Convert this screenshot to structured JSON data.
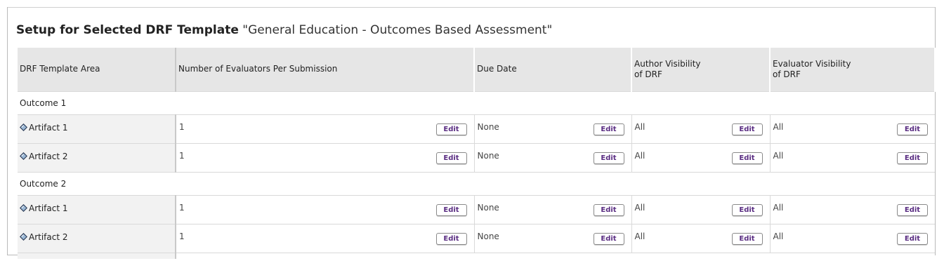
{
  "header": {
    "title_bold": "Setup for Selected DRF Template",
    "title_rest": "\"General Education - Outcomes Based Assessment\""
  },
  "table": {
    "columns": [
      "DRF Template Area",
      "Number of Evaluators Per Submission",
      "Due Date",
      "Author Visibility\nof DRF",
      "Evaluator Visibility\nof DRF"
    ],
    "edit_label": "Edit",
    "groups": [
      {
        "name": "Outcome 1",
        "rows": [
          {
            "area": "Artifact 1",
            "evaluators": "1",
            "due_date": "None",
            "author_visibility": "All",
            "evaluator_visibility": "All"
          },
          {
            "area": "Artifact 2",
            "evaluators": "1",
            "due_date": "None",
            "author_visibility": "All",
            "evaluator_visibility": "All"
          }
        ]
      },
      {
        "name": "Outcome 2",
        "rows": [
          {
            "area": "Artifact 1",
            "evaluators": "1",
            "due_date": "None",
            "author_visibility": "All",
            "evaluator_visibility": "All"
          },
          {
            "area": "Artifact 2",
            "evaluators": "1",
            "due_date": "None",
            "author_visibility": "All",
            "evaluator_visibility": "All"
          }
        ]
      }
    ]
  },
  "colors": {
    "edit_text": "#5a2d82",
    "header_bg": "#e6e6e6",
    "area_bg": "#f2f2f2"
  }
}
